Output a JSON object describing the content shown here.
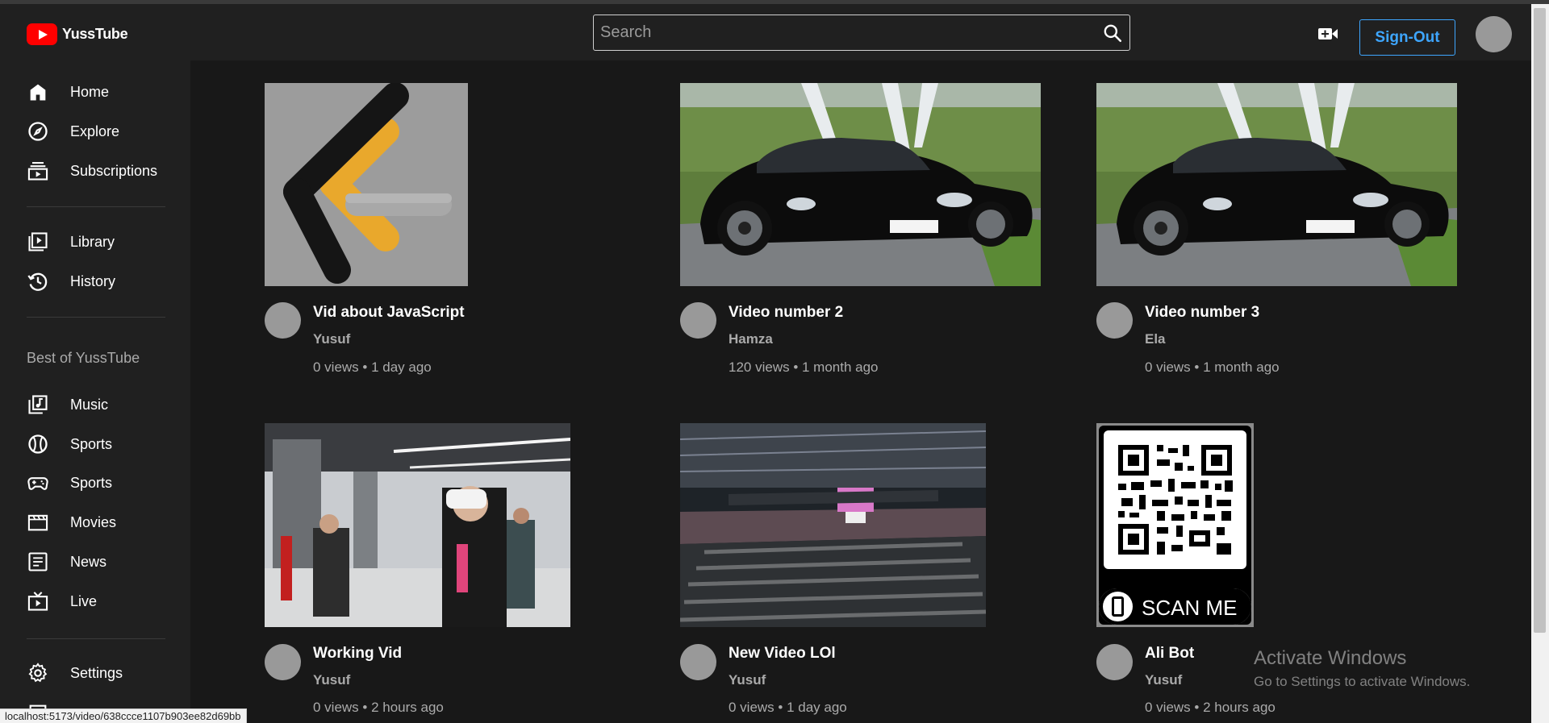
{
  "app": {
    "name": "YussTube"
  },
  "header": {
    "search_placeholder": "Search",
    "signout_label": "Sign-Out"
  },
  "sidebar": {
    "items": [
      {
        "label": "Home",
        "icon": "home-icon"
      },
      {
        "label": "Explore",
        "icon": "explore-icon"
      },
      {
        "label": "Subscriptions",
        "icon": "subscriptions-icon"
      },
      {
        "label": "Library",
        "icon": "library-icon"
      },
      {
        "label": "History",
        "icon": "history-icon"
      }
    ],
    "section_title": "Best of YussTube",
    "best_items": [
      {
        "label": "Music",
        "icon": "music-icon"
      },
      {
        "label": "Sports",
        "icon": "sports-icon"
      },
      {
        "label": "Sports",
        "icon": "gamepad-icon"
      },
      {
        "label": "Movies",
        "icon": "movies-icon"
      },
      {
        "label": "News",
        "icon": "news-icon"
      },
      {
        "label": "Live",
        "icon": "live-icon"
      }
    ],
    "settings": {
      "label": "Settings",
      "icon": "gear-icon"
    }
  },
  "videos": [
    {
      "title": "Vid about JavaScript",
      "channel": "Yusuf",
      "meta": "0 views • 1 day ago",
      "thumb": "js-logo"
    },
    {
      "title": "Video number 2",
      "channel": "Hamza",
      "meta": "120 views • 1 month ago",
      "thumb": "black-car"
    },
    {
      "title": "Video number 3",
      "channel": "Ela",
      "meta": "0 views • 1 month ago",
      "thumb": "black-car"
    },
    {
      "title": "Working Vid",
      "channel": "Yusuf",
      "meta": "0 views • 2 hours ago",
      "thumb": "vr-expo"
    },
    {
      "title": "New Video LOl",
      "channel": "Yusuf",
      "meta": "0 views • 1 day ago",
      "thumb": "arena"
    },
    {
      "title": "Ali Bot",
      "channel": "Yusuf",
      "meta": "0 views • 2 hours ago",
      "thumb": "qr-code",
      "thumb_text": "SCAN ME"
    }
  ],
  "watermark": {
    "title": "Activate Windows",
    "subtitle": "Go to Settings to activate Windows."
  },
  "status_bar": {
    "url": "localhost:5173/video/638ccce1107b903ee82d69bb"
  },
  "colors": {
    "accent": "#3ea6ff",
    "brand": "#ff0000",
    "background": "#181818",
    "panel": "#202020"
  }
}
